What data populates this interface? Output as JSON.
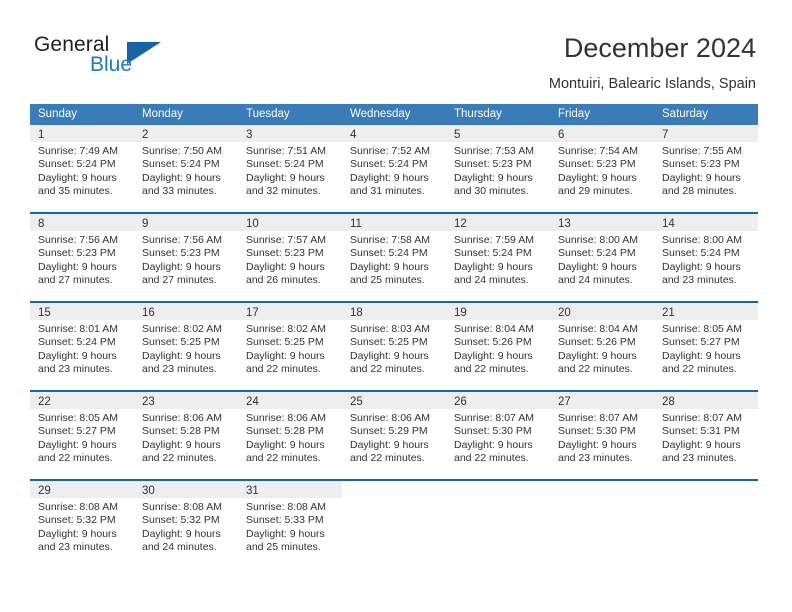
{
  "logo": {
    "word_one": "General",
    "word_two": "Blue",
    "triangle_color": "#1664a6"
  },
  "header": {
    "title": "December 2024",
    "location": "Montuiri, Balearic Islands, Spain"
  },
  "theme": {
    "header_blue": "#3a7cb9",
    "rule_blue": "#1b64a5",
    "band_gray": "#eeeeee"
  },
  "weekdays": [
    "Sunday",
    "Monday",
    "Tuesday",
    "Wednesday",
    "Thursday",
    "Friday",
    "Saturday"
  ],
  "weeks": [
    [
      {
        "num": "1",
        "sunrise": "Sunrise: 7:49 AM",
        "sunset": "Sunset: 5:24 PM",
        "daylight_1": "Daylight: 9 hours",
        "daylight_2": "and 35 minutes."
      },
      {
        "num": "2",
        "sunrise": "Sunrise: 7:50 AM",
        "sunset": "Sunset: 5:24 PM",
        "daylight_1": "Daylight: 9 hours",
        "daylight_2": "and 33 minutes."
      },
      {
        "num": "3",
        "sunrise": "Sunrise: 7:51 AM",
        "sunset": "Sunset: 5:24 PM",
        "daylight_1": "Daylight: 9 hours",
        "daylight_2": "and 32 minutes."
      },
      {
        "num": "4",
        "sunrise": "Sunrise: 7:52 AM",
        "sunset": "Sunset: 5:24 PM",
        "daylight_1": "Daylight: 9 hours",
        "daylight_2": "and 31 minutes."
      },
      {
        "num": "5",
        "sunrise": "Sunrise: 7:53 AM",
        "sunset": "Sunset: 5:23 PM",
        "daylight_1": "Daylight: 9 hours",
        "daylight_2": "and 30 minutes."
      },
      {
        "num": "6",
        "sunrise": "Sunrise: 7:54 AM",
        "sunset": "Sunset: 5:23 PM",
        "daylight_1": "Daylight: 9 hours",
        "daylight_2": "and 29 minutes."
      },
      {
        "num": "7",
        "sunrise": "Sunrise: 7:55 AM",
        "sunset": "Sunset: 5:23 PM",
        "daylight_1": "Daylight: 9 hours",
        "daylight_2": "and 28 minutes."
      }
    ],
    [
      {
        "num": "8",
        "sunrise": "Sunrise: 7:56 AM",
        "sunset": "Sunset: 5:23 PM",
        "daylight_1": "Daylight: 9 hours",
        "daylight_2": "and 27 minutes."
      },
      {
        "num": "9",
        "sunrise": "Sunrise: 7:56 AM",
        "sunset": "Sunset: 5:23 PM",
        "daylight_1": "Daylight: 9 hours",
        "daylight_2": "and 27 minutes."
      },
      {
        "num": "10",
        "sunrise": "Sunrise: 7:57 AM",
        "sunset": "Sunset: 5:23 PM",
        "daylight_1": "Daylight: 9 hours",
        "daylight_2": "and 26 minutes."
      },
      {
        "num": "11",
        "sunrise": "Sunrise: 7:58 AM",
        "sunset": "Sunset: 5:24 PM",
        "daylight_1": "Daylight: 9 hours",
        "daylight_2": "and 25 minutes."
      },
      {
        "num": "12",
        "sunrise": "Sunrise: 7:59 AM",
        "sunset": "Sunset: 5:24 PM",
        "daylight_1": "Daylight: 9 hours",
        "daylight_2": "and 24 minutes."
      },
      {
        "num": "13",
        "sunrise": "Sunrise: 8:00 AM",
        "sunset": "Sunset: 5:24 PM",
        "daylight_1": "Daylight: 9 hours",
        "daylight_2": "and 24 minutes."
      },
      {
        "num": "14",
        "sunrise": "Sunrise: 8:00 AM",
        "sunset": "Sunset: 5:24 PM",
        "daylight_1": "Daylight: 9 hours",
        "daylight_2": "and 23 minutes."
      }
    ],
    [
      {
        "num": "15",
        "sunrise": "Sunrise: 8:01 AM",
        "sunset": "Sunset: 5:24 PM",
        "daylight_1": "Daylight: 9 hours",
        "daylight_2": "and 23 minutes."
      },
      {
        "num": "16",
        "sunrise": "Sunrise: 8:02 AM",
        "sunset": "Sunset: 5:25 PM",
        "daylight_1": "Daylight: 9 hours",
        "daylight_2": "and 23 minutes."
      },
      {
        "num": "17",
        "sunrise": "Sunrise: 8:02 AM",
        "sunset": "Sunset: 5:25 PM",
        "daylight_1": "Daylight: 9 hours",
        "daylight_2": "and 22 minutes."
      },
      {
        "num": "18",
        "sunrise": "Sunrise: 8:03 AM",
        "sunset": "Sunset: 5:25 PM",
        "daylight_1": "Daylight: 9 hours",
        "daylight_2": "and 22 minutes."
      },
      {
        "num": "19",
        "sunrise": "Sunrise: 8:04 AM",
        "sunset": "Sunset: 5:26 PM",
        "daylight_1": "Daylight: 9 hours",
        "daylight_2": "and 22 minutes."
      },
      {
        "num": "20",
        "sunrise": "Sunrise: 8:04 AM",
        "sunset": "Sunset: 5:26 PM",
        "daylight_1": "Daylight: 9 hours",
        "daylight_2": "and 22 minutes."
      },
      {
        "num": "21",
        "sunrise": "Sunrise: 8:05 AM",
        "sunset": "Sunset: 5:27 PM",
        "daylight_1": "Daylight: 9 hours",
        "daylight_2": "and 22 minutes."
      }
    ],
    [
      {
        "num": "22",
        "sunrise": "Sunrise: 8:05 AM",
        "sunset": "Sunset: 5:27 PM",
        "daylight_1": "Daylight: 9 hours",
        "daylight_2": "and 22 minutes."
      },
      {
        "num": "23",
        "sunrise": "Sunrise: 8:06 AM",
        "sunset": "Sunset: 5:28 PM",
        "daylight_1": "Daylight: 9 hours",
        "daylight_2": "and 22 minutes."
      },
      {
        "num": "24",
        "sunrise": "Sunrise: 8:06 AM",
        "sunset": "Sunset: 5:28 PM",
        "daylight_1": "Daylight: 9 hours",
        "daylight_2": "and 22 minutes."
      },
      {
        "num": "25",
        "sunrise": "Sunrise: 8:06 AM",
        "sunset": "Sunset: 5:29 PM",
        "daylight_1": "Daylight: 9 hours",
        "daylight_2": "and 22 minutes."
      },
      {
        "num": "26",
        "sunrise": "Sunrise: 8:07 AM",
        "sunset": "Sunset: 5:30 PM",
        "daylight_1": "Daylight: 9 hours",
        "daylight_2": "and 22 minutes."
      },
      {
        "num": "27",
        "sunrise": "Sunrise: 8:07 AM",
        "sunset": "Sunset: 5:30 PM",
        "daylight_1": "Daylight: 9 hours",
        "daylight_2": "and 23 minutes."
      },
      {
        "num": "28",
        "sunrise": "Sunrise: 8:07 AM",
        "sunset": "Sunset: 5:31 PM",
        "daylight_1": "Daylight: 9 hours",
        "daylight_2": "and 23 minutes."
      }
    ],
    [
      {
        "num": "29",
        "sunrise": "Sunrise: 8:08 AM",
        "sunset": "Sunset: 5:32 PM",
        "daylight_1": "Daylight: 9 hours",
        "daylight_2": "and 23 minutes."
      },
      {
        "num": "30",
        "sunrise": "Sunrise: 8:08 AM",
        "sunset": "Sunset: 5:32 PM",
        "daylight_1": "Daylight: 9 hours",
        "daylight_2": "and 24 minutes."
      },
      {
        "num": "31",
        "sunrise": "Sunrise: 8:08 AM",
        "sunset": "Sunset: 5:33 PM",
        "daylight_1": "Daylight: 9 hours",
        "daylight_2": "and 25 minutes."
      },
      {
        "num": "",
        "sunrise": "",
        "sunset": "",
        "daylight_1": "",
        "daylight_2": ""
      },
      {
        "num": "",
        "sunrise": "",
        "sunset": "",
        "daylight_1": "",
        "daylight_2": ""
      },
      {
        "num": "",
        "sunrise": "",
        "sunset": "",
        "daylight_1": "",
        "daylight_2": ""
      },
      {
        "num": "",
        "sunrise": "",
        "sunset": "",
        "daylight_1": "",
        "daylight_2": ""
      }
    ]
  ]
}
